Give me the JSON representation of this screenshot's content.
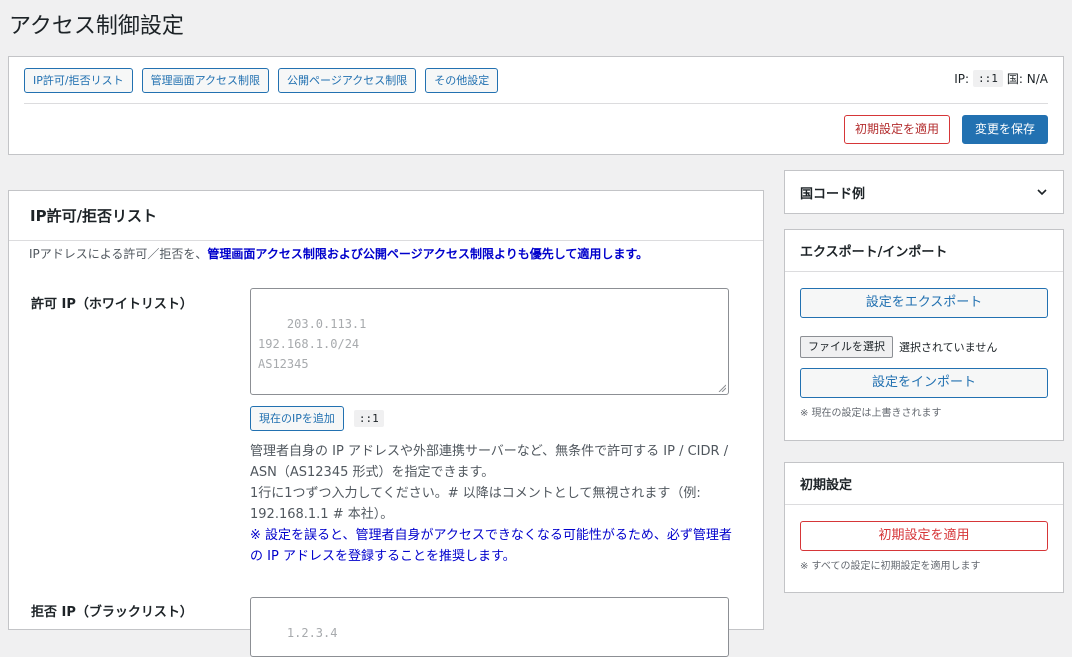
{
  "page": {
    "title": "アクセス制御設定"
  },
  "topbar": {
    "tabs": [
      {
        "label": "IP許可/拒否リスト"
      },
      {
        "label": "管理画面アクセス制限"
      },
      {
        "label": "公開ページアクセス制限"
      },
      {
        "label": "その他設定"
      }
    ],
    "ip_label": "IP:",
    "ip_value": "::1",
    "country": "国: N/A",
    "reset_label": "初期設定を適用",
    "save_label": "変更を保存"
  },
  "main": {
    "title": "IP許可/拒否リスト",
    "desc_prefix": "IPアドレスによる許可／拒否を、",
    "desc_strong": "管理画面アクセス制限および公開ページアクセス制限よりも優先して適用します。",
    "allow": {
      "label": "許可 IP（ホワイトリスト）",
      "placeholder": "203.0.113.1\n192.168.1.0/24\nAS12345",
      "add_current_label": "現在のIPを追加",
      "current_ip": "::1",
      "help1": "管理者自身の IP アドレスや外部連携サーバーなど、無条件で許可する IP / CIDR / ASN（AS12345 形式）を指定できます。",
      "help2": "1行に1つずつ入力してください。# 以降はコメントとして無視されます（例: 192.168.1.1 # 本社）。",
      "warning": "※ 設定を誤ると、管理者自身がアクセスできなくなる可能性がるため、必ず管理者の IP アドレスを登録することを推奨します。"
    },
    "deny": {
      "label": "拒否 IP（ブラックリスト）",
      "placeholder": "1.2.3.4"
    }
  },
  "sidebar": {
    "country_codes": {
      "title": "国コード例"
    },
    "export_import": {
      "title": "エクスポート/インポート",
      "export_label": "設定をエクスポート",
      "file_button": "ファイルを選択",
      "file_status": "選択されていません",
      "import_label": "設定をインポート",
      "note": "※ 現在の設定は上書きされます"
    },
    "reset": {
      "title": "初期設定",
      "button": "初期設定を適用",
      "note": "※ すべての設定に初期設定を適用します"
    }
  },
  "colors": {
    "accent": "#2271b1",
    "danger": "#d63638",
    "emphasis": "#0000cc"
  }
}
